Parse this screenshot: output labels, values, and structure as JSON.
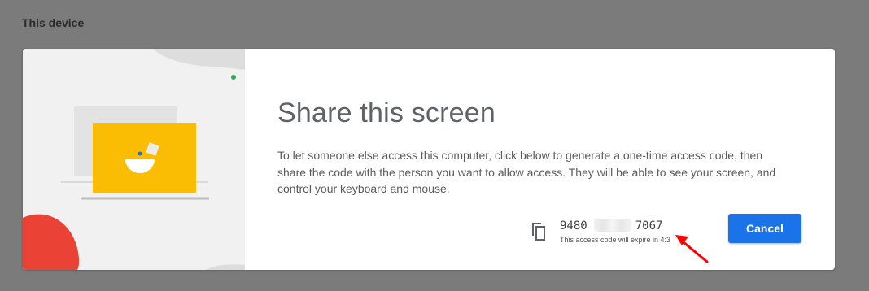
{
  "section": {
    "label": "This device"
  },
  "dialog": {
    "title": "Share this screen",
    "description": "To let someone else access this computer, click below to generate a one-time access code, then share the code with the person you want to allow access. They will be able to see your screen, and control your keyboard and mouse.",
    "access_code_start": "9480",
    "access_code_end": "7067",
    "expire_text": "This access code will expire in 4:3",
    "cancel_label": "Cancel",
    "copy_icon": "copy-icon"
  },
  "colors": {
    "backdrop": "#7b7b7b",
    "accent_blue": "#1a73e8",
    "laptop_yellow": "#fbbc04",
    "blob_red": "#ea4335",
    "dot_green": "#34a853",
    "annotation_red": "#ff0000"
  }
}
